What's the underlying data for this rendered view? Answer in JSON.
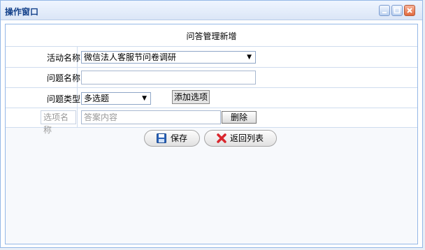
{
  "window": {
    "title": "操作窗口"
  },
  "form": {
    "heading": "问答管理新增",
    "activity_label": "活动名称",
    "activity_value": "微信法人客服节问卷调研",
    "question_label": "问题名称",
    "question_value": "",
    "type_label": "问题类型",
    "type_value": "多选题",
    "add_option_label": "添加选项",
    "option_placeholder": "选项名称",
    "answer_placeholder": "答案内容",
    "delete_label": "删除",
    "save_label": "保存",
    "back_label": "返回列表"
  }
}
